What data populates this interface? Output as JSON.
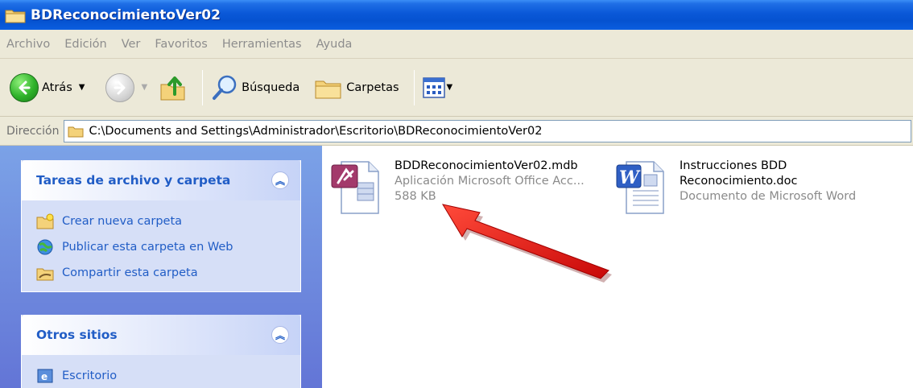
{
  "window": {
    "title": "BDReconocimientoVer02"
  },
  "menu": [
    "Archivo",
    "Edición",
    "Ver",
    "Favoritos",
    "Herramientas",
    "Ayuda"
  ],
  "toolbar": {
    "back_label": "Atrás",
    "search_label": "Búsqueda",
    "folders_label": "Carpetas"
  },
  "address": {
    "label": "Dirección",
    "path": "C:\\Documents and Settings\\Administrador\\Escritorio\\BDReconocimientoVer02"
  },
  "tasks_panel": {
    "title": "Tareas de archivo y carpeta",
    "items": [
      {
        "label": "Crear nueva carpeta",
        "icon": "new-folder-icon"
      },
      {
        "label": "Publicar esta carpeta en Web",
        "icon": "publish-web-icon"
      },
      {
        "label": "Compartir esta carpeta",
        "icon": "share-folder-icon"
      }
    ]
  },
  "other_places_panel": {
    "title": "Otros sitios",
    "items": [
      {
        "label": "Escritorio",
        "icon": "desktop-icon"
      }
    ]
  },
  "files": [
    {
      "name": "BDDReconocimientoVer02.mdb",
      "type": "Aplicación Microsoft Office Acc...",
      "size": "588 KB",
      "icon": "access-file-icon"
    },
    {
      "name_line1": "Instrucciones BDD",
      "name_line2": "Reconocimiento.doc",
      "type": "Documento de Microsoft Word",
      "icon": "word-file-icon"
    }
  ],
  "colors": {
    "titlebar": "#0552d0",
    "task_link": "#215dc6",
    "annotation_arrow": "#e01010"
  }
}
